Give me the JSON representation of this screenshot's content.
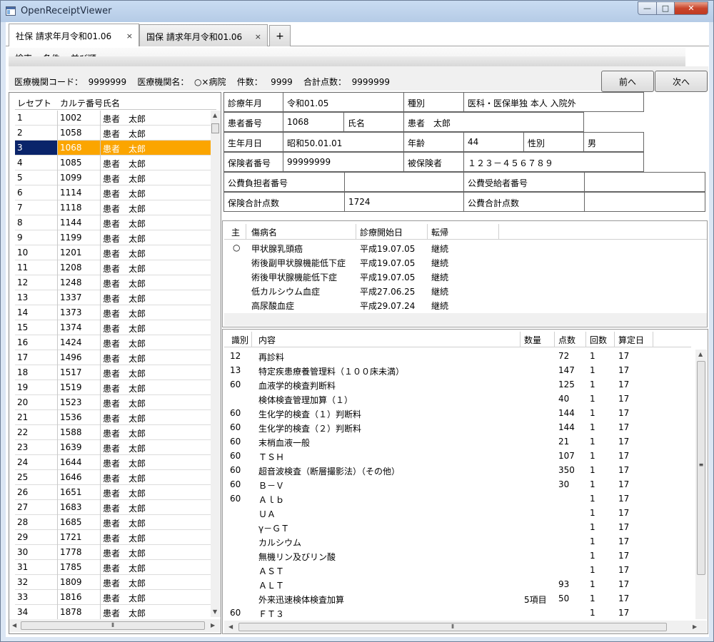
{
  "window": {
    "title": "OpenReceiptViewer",
    "min": "—",
    "max": "□",
    "close": "✕"
  },
  "tabs": [
    {
      "label": "社保  請求年月令和01.06",
      "close": "×"
    },
    {
      "label": "国保  請求年月令和01.06",
      "close": "×"
    }
  ],
  "tab_add": "+",
  "menu": {
    "search": "検索",
    "conditions": "条件",
    "sort": "並び順"
  },
  "info": {
    "text": "医療機関コード：  9999999    医療機関名：  ○×病院    件数：   9999    合計点数：  9999999"
  },
  "nav": {
    "prev": "前へ",
    "next": "次へ"
  },
  "list": {
    "headers": [
      "レセプト",
      "カルテ番号",
      "氏名"
    ],
    "selected_index": 2,
    "rows": [
      [
        "1",
        "1002",
        "患者　太郎"
      ],
      [
        "2",
        "1058",
        "患者　太郎"
      ],
      [
        "3",
        "1068",
        "患者　太郎"
      ],
      [
        "4",
        "1085",
        "患者　太郎"
      ],
      [
        "5",
        "1099",
        "患者　太郎"
      ],
      [
        "6",
        "1114",
        "患者　太郎"
      ],
      [
        "7",
        "1118",
        "患者　太郎"
      ],
      [
        "8",
        "1144",
        "患者　太郎"
      ],
      [
        "9",
        "1199",
        "患者　太郎"
      ],
      [
        "10",
        "1201",
        "患者　太郎"
      ],
      [
        "11",
        "1208",
        "患者　太郎"
      ],
      [
        "12",
        "1248",
        "患者　太郎"
      ],
      [
        "13",
        "1337",
        "患者　太郎"
      ],
      [
        "14",
        "1373",
        "患者　太郎"
      ],
      [
        "15",
        "1374",
        "患者　太郎"
      ],
      [
        "16",
        "1424",
        "患者　太郎"
      ],
      [
        "17",
        "1496",
        "患者　太郎"
      ],
      [
        "18",
        "1517",
        "患者　太郎"
      ],
      [
        "19",
        "1519",
        "患者　太郎"
      ],
      [
        "20",
        "1523",
        "患者　太郎"
      ],
      [
        "21",
        "1536",
        "患者　太郎"
      ],
      [
        "22",
        "1588",
        "患者　太郎"
      ],
      [
        "23",
        "1639",
        "患者　太郎"
      ],
      [
        "24",
        "1644",
        "患者　太郎"
      ],
      [
        "25",
        "1646",
        "患者　太郎"
      ],
      [
        "26",
        "1651",
        "患者　太郎"
      ],
      [
        "27",
        "1683",
        "患者　太郎"
      ],
      [
        "28",
        "1685",
        "患者　太郎"
      ],
      [
        "29",
        "1721",
        "患者　太郎"
      ],
      [
        "30",
        "1778",
        "患者　太郎"
      ],
      [
        "31",
        "1785",
        "患者　太郎"
      ],
      [
        "32",
        "1809",
        "患者　太郎"
      ],
      [
        "33",
        "1816",
        "患者　太郎"
      ],
      [
        "34",
        "1878",
        "患者　太郎"
      ]
    ]
  },
  "patient": {
    "shinryo_ym_label": "診療年月",
    "shinryo_ym": "令和01.05",
    "shubetsu_label": "種別",
    "shubetsu": "医科・医保単独 本人 入院外",
    "kanja_no_label": "患者番号",
    "kanja_no": "1068",
    "name_label": "氏名",
    "name": "患者　太郎",
    "birth_label": "生年月日",
    "birth": "昭和50.01.01",
    "age_label": "年齢",
    "age": "44",
    "sex_label": "性別",
    "sex": "男",
    "hokensha_label": "保険者番号",
    "hokensha": "99999999",
    "hihokensha_label": "被保険者",
    "hihokensha": "１２３－４５６７８９",
    "kouhi_futan_label": "公費負担者番号",
    "kouhi_futan": "",
    "kouhi_jukyu_label": "公費受給者番号",
    "kouhi_jukyu": "",
    "hoken_total_label": "保険合計点数",
    "hoken_total": "1724",
    "kouhi_total_label": "公費合計点数",
    "kouhi_total": ""
  },
  "diseases": {
    "headers": [
      "主",
      "傷病名",
      "診療開始日",
      "転帰"
    ],
    "rows": [
      [
        "○",
        "甲状腺乳頭癌",
        "平成19.07.05",
        "継続"
      ],
      [
        "",
        "術後副甲状腺機能低下症",
        "平成19.07.05",
        "継続"
      ],
      [
        "",
        "術後甲状腺機能低下症",
        "平成19.07.05",
        "継続"
      ],
      [
        "",
        "低カルシウム血症",
        "平成27.06.25",
        "継続"
      ],
      [
        "",
        "高尿酸血症",
        "平成29.07.24",
        "継続"
      ]
    ]
  },
  "items": {
    "headers": [
      "識別",
      "内容",
      "数量",
      "点数",
      "回数",
      "算定日"
    ],
    "rows": [
      [
        "12",
        "再診料",
        "",
        "72",
        "1",
        "17"
      ],
      [
        "13",
        "特定疾患療養管理料（１００床未満）",
        "",
        "147",
        "1",
        "17"
      ],
      [
        "60",
        "血液学的検査判断料",
        "",
        "125",
        "1",
        "17"
      ],
      [
        "",
        "検体検査管理加算（１）",
        "",
        "40",
        "1",
        "17"
      ],
      [
        "60",
        "生化学的検査（１）判断料",
        "",
        "144",
        "1",
        "17"
      ],
      [
        "60",
        "生化学的検査（２）判断料",
        "",
        "144",
        "1",
        "17"
      ],
      [
        "60",
        "末梢血液一般",
        "",
        "21",
        "1",
        "17"
      ],
      [
        "60",
        "ＴＳＨ",
        "",
        "107",
        "1",
        "17"
      ],
      [
        "60",
        "超音波検査（断層撮影法）（その他）",
        "",
        "350",
        "1",
        "17"
      ],
      [
        "60",
        "Ｂ－Ｖ",
        "",
        "30",
        "1",
        "17"
      ],
      [
        "60",
        "Ａｌｂ",
        "",
        "",
        "1",
        "17"
      ],
      [
        "",
        "ＵＡ",
        "",
        "",
        "1",
        "17"
      ],
      [
        "",
        "γ－ＧＴ",
        "",
        "",
        "1",
        "17"
      ],
      [
        "",
        "カルシウム",
        "",
        "",
        "1",
        "17"
      ],
      [
        "",
        "無機リン及びリン酸",
        "",
        "",
        "1",
        "17"
      ],
      [
        "",
        "ＡＳＴ",
        "",
        "",
        "1",
        "17"
      ],
      [
        "",
        "ＡＬＴ",
        "",
        "93",
        "1",
        "17"
      ],
      [
        "",
        "外来迅速検体検査加算",
        "5項目",
        "50",
        "1",
        "17"
      ],
      [
        "60",
        "ＦＴ３",
        "",
        "",
        "1",
        "17"
      ]
    ]
  },
  "colors": {
    "selected_row": "#fba500",
    "selected_cell": "#0a246a"
  }
}
